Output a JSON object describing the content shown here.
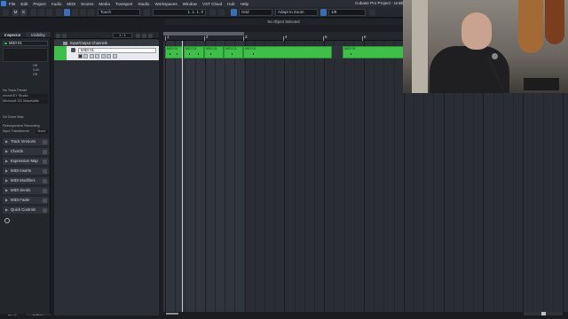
{
  "menubar": {
    "items": [
      "File",
      "Edit",
      "Project",
      "Audio",
      "MIDI",
      "Scores",
      "Media",
      "Transport",
      "Studio",
      "Workspaces",
      "Window",
      "VST Cloud",
      "Hub",
      "Help"
    ],
    "window_title": "Cubase Pro Project - Untitled1"
  },
  "toolbar": {
    "m_label": "M",
    "s_label": "S",
    "automation_mode": "Touch",
    "position_display": "1. 1. 1. 0",
    "snap_type": "Grid",
    "snap_mode": "Adapt to Zoom",
    "quantize": "1/8"
  },
  "infoline": {
    "text": "No Object Selected"
  },
  "left_zone": {
    "tabs": [
      "Inspector",
      "Visibility"
    ],
    "track_name": "MIDI 01",
    "rows": [
      {
        "label": "Off"
      },
      {
        "label": "0.00"
      },
      {
        "label": "Off"
      },
      {
        "label": "No Track Preset"
      },
      {
        "label": "microKEY Studio"
      },
      {
        "label": "Microsoft GS Wavetable"
      },
      {
        "label": "No Drum Map"
      }
    ],
    "retrospective": "Retrospective Recording",
    "input_transformer_label": "Input Transformer",
    "input_transformer_value": "None",
    "sections": [
      "Track Versions",
      "Chords",
      "Expression Map",
      "MIDI Inserts",
      "MIDI Modifiers",
      "MIDI Sends",
      "MIDI Fader",
      "Quick Controls"
    ],
    "bottom_tabs": [
      "Track",
      "Editor"
    ]
  },
  "tracklist": {
    "counter": "1 / 1",
    "folder_label": "Input/Output Channels",
    "track_name": "MIDI 01",
    "track_color": "#3fbf4a"
  },
  "ruler": {
    "bars": [
      "1",
      "2",
      "3",
      "4",
      "5",
      "6"
    ]
  },
  "parts": [
    {
      "label": "MIDI 01"
    },
    {
      "label": "MIDI 01"
    },
    {
      "label": "MIDI 01"
    },
    {
      "label": "MIDI 01"
    },
    {
      "label": "MIDI 01"
    },
    {
      "label": "MIDI 01"
    }
  ],
  "colors": {
    "midi_part": "#3fbf4a",
    "accent": "#3b6fb5"
  }
}
